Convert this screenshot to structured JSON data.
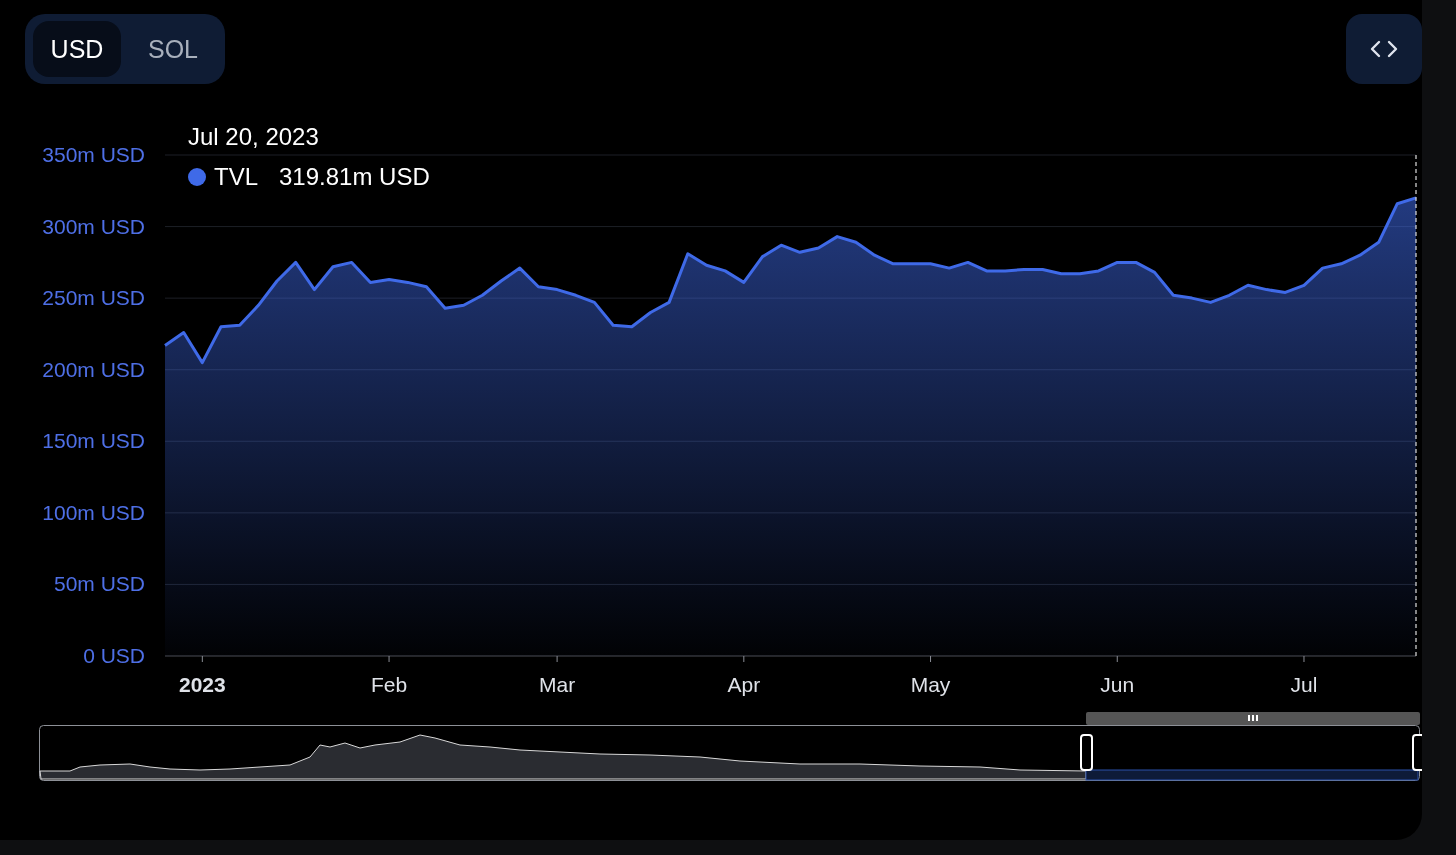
{
  "currency_toggle": [
    {
      "label": "USD",
      "selected": true
    },
    {
      "label": "SOL",
      "selected": false
    }
  ],
  "chart": {
    "tooltip": {
      "date": "Jul 20, 2023",
      "value": "319.81m USD"
    },
    "chart_data": {
      "type": "area",
      "categories": [
        null,
        null,
        "2023",
        null,
        null,
        null,
        null,
        null,
        null,
        null,
        null,
        null,
        "Feb",
        null,
        null,
        null,
        null,
        null,
        null,
        null,
        null,
        "Mar",
        null,
        null,
        null,
        null,
        null,
        null,
        null,
        null,
        null,
        "Apr",
        null,
        null,
        null,
        null,
        null,
        null,
        null,
        null,
        null,
        "May",
        null,
        null,
        null,
        null,
        null,
        null,
        null,
        null,
        null,
        "Jun",
        null,
        null,
        null,
        null,
        null,
        null,
        null,
        null,
        null,
        "Jul",
        null,
        null,
        null,
        null,
        null,
        null
      ],
      "series": [
        {
          "name": "TVL",
          "color": "#3f6ae8",
          "values": [
            217,
            226,
            205,
            230,
            231,
            245,
            262,
            275,
            256,
            272,
            275,
            261,
            263,
            261,
            258,
            243,
            245,
            252,
            262,
            271,
            258,
            256,
            252,
            247,
            231,
            230,
            240,
            247,
            281,
            273,
            269,
            261,
            279,
            287,
            282,
            285,
            293,
            289,
            280,
            274,
            274,
            274,
            271,
            275,
            269,
            269,
            270,
            270,
            267,
            267,
            269,
            275,
            275,
            268,
            252,
            250,
            247,
            252,
            259,
            256,
            254,
            259,
            271,
            274,
            280,
            289,
            316,
            320
          ]
        }
      ],
      "ylim": [
        0,
        350
      ],
      "grid": true,
      "yticks": [
        {
          "value": 0,
          "label": "0 USD"
        },
        {
          "value": 50,
          "label": "50m USD"
        },
        {
          "value": 100,
          "label": "100m USD"
        },
        {
          "value": 150,
          "label": "150m USD"
        },
        {
          "value": 200,
          "label": "200m USD"
        },
        {
          "value": 250,
          "label": "250m USD"
        },
        {
          "value": 300,
          "label": "300m USD"
        },
        {
          "value": 350,
          "label": "350m USD"
        }
      ]
    }
  }
}
